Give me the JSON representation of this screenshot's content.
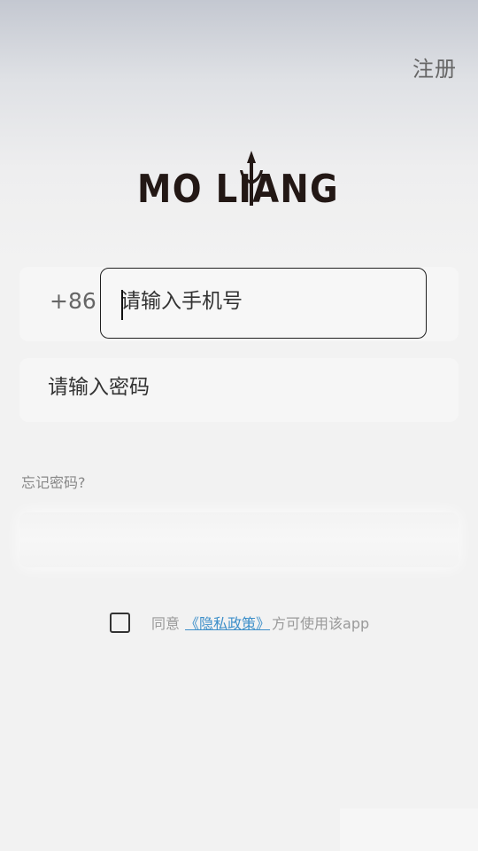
{
  "header": {
    "register_label": "注册"
  },
  "logo": {
    "text": "MO LIANG",
    "color": "#231815"
  },
  "phone_field": {
    "country_code": "+86",
    "placeholder": "请输入手机号",
    "value": ""
  },
  "password_field": {
    "placeholder": "请输入密码",
    "value": ""
  },
  "forgot_password_label": "忘记密码?",
  "login_button": {
    "label": ""
  },
  "agreement": {
    "checked": false,
    "prefix": "同意",
    "policy_link": "《隐私政策》",
    "suffix": "方可使用该app"
  },
  "colors": {
    "link_blue": "#3d8fc9",
    "text_dark": "#333333",
    "text_gray": "#999999"
  }
}
